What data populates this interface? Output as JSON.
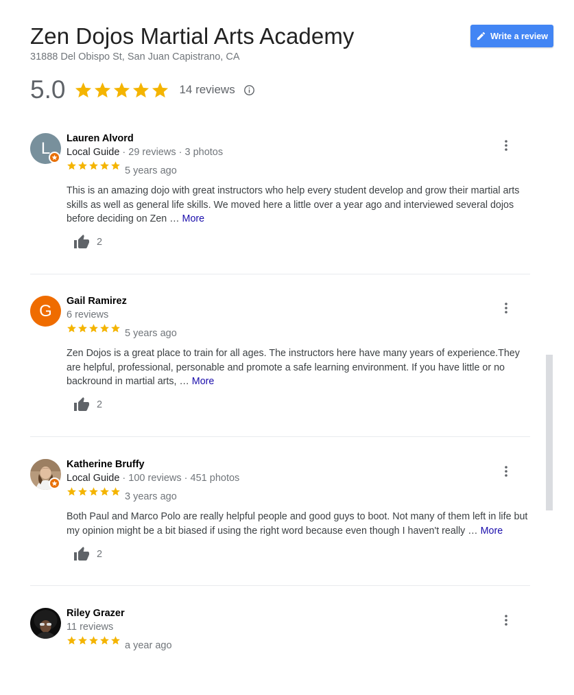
{
  "business": {
    "name": "Zen Dojos Martial Arts Academy",
    "address": "31888 Del Obispo St, San Juan Capistrano, CA"
  },
  "write_review": {
    "label": "Write a review",
    "icon": "pencil-icon"
  },
  "summary": {
    "rating": "5.0",
    "stars": 5,
    "review_count": "14 reviews",
    "info_icon": "info-icon"
  },
  "colors": {
    "star": "#f4b400",
    "accent": "#4285f4",
    "more_link": "#1a0dab",
    "local_guide_badge": "#e8710a"
  },
  "reviews": [
    {
      "name": "Lauren Alvord",
      "avatar_initial": "L",
      "avatar_color": "#78909c",
      "local_guide": true,
      "guide_label": "Local Guide",
      "meta": "· 29 reviews · 3 photos",
      "stars": 5,
      "date": "5 years ago",
      "text": "This is an amazing dojo with great instructors who help every student develop and grow their martial arts skills as well as general life skills. We moved here a little over a year ago and interviewed several dojos before deciding on Zen …",
      "more": "More",
      "likes": "2"
    },
    {
      "name": "Gail Ramirez",
      "avatar_initial": "G",
      "avatar_color": "#ef6c00",
      "local_guide": false,
      "guide_label": "",
      "meta": "6 reviews",
      "stars": 5,
      "date": "5 years ago",
      "text": "Zen Dojos is a great place to train for all ages. The instructors here have many years of experience.They are helpful, professional, personable and promote a safe learning environment. If you have little or no backround in martial arts, …",
      "more": "More",
      "likes": "2"
    },
    {
      "name": "Katherine Bruffy",
      "avatar_initial": "",
      "avatar_color": "#8d6e63",
      "local_guide": true,
      "guide_label": "Local Guide",
      "meta": "· 100 reviews · 451 photos",
      "stars": 5,
      "date": "3 years ago",
      "text": "Both Paul and Marco Polo are really helpful people and good guys to boot. Not many of them left in life but my opinion might be a bit biased if using the right word because even though I haven't really …",
      "more": "More",
      "likes": "2"
    },
    {
      "name": "Riley Grazer",
      "avatar_initial": "",
      "avatar_color": "#111111",
      "local_guide": false,
      "guide_label": "",
      "meta": "11 reviews",
      "stars": 5,
      "date": "a year ago"
    }
  ]
}
